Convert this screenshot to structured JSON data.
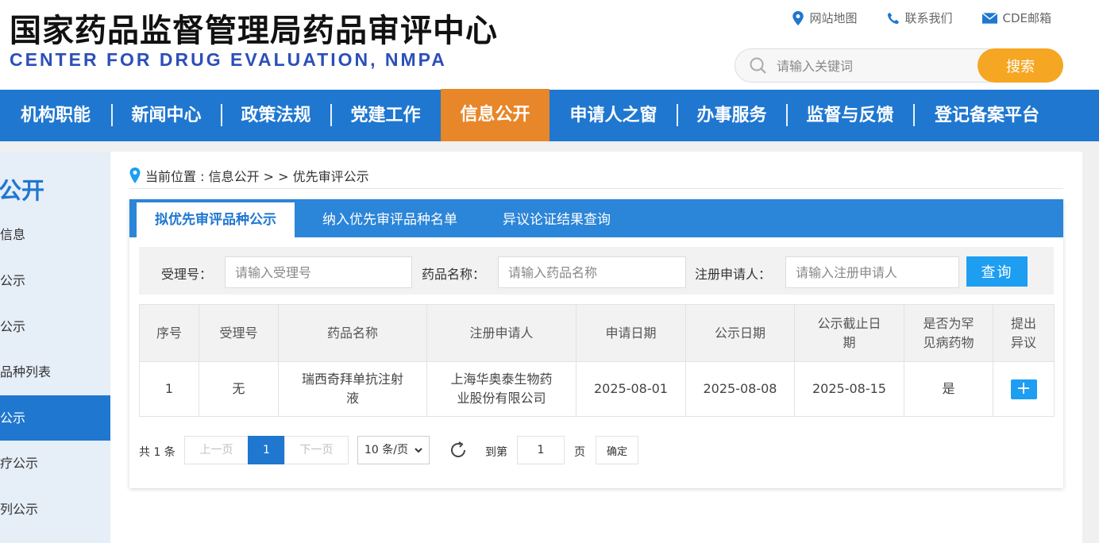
{
  "header": {
    "title": "国家药品监督管理局药品审评中心",
    "subtitle": "CENTER FOR DRUG EVALUATION, NMPA",
    "links": [
      {
        "label": "网站地图",
        "icon": "location-pin-icon"
      },
      {
        "label": "联系我们",
        "icon": "phone-icon"
      },
      {
        "label": "CDE邮箱",
        "icon": "mail-icon"
      }
    ],
    "search": {
      "placeholder": "请输入关键词",
      "button_label": "搜索"
    }
  },
  "nav": {
    "items": [
      {
        "label": "机构职能"
      },
      {
        "label": "新闻中心"
      },
      {
        "label": "政策法规"
      },
      {
        "label": "党建工作"
      },
      {
        "label": "信息公开",
        "active": true
      },
      {
        "label": "申请人之窗"
      },
      {
        "label": "办事服务"
      },
      {
        "label": "监督与反馈"
      },
      {
        "label": "登记备案平台"
      }
    ]
  },
  "sidebar": {
    "title": "公开",
    "items": [
      {
        "label": "信息"
      },
      {
        "label": "公示"
      },
      {
        "label": "公示"
      },
      {
        "label": "品种列表"
      },
      {
        "label": "公示",
        "active": true
      },
      {
        "label": "疗公示"
      },
      {
        "label": "列公示"
      }
    ]
  },
  "breadcrumb": {
    "text": "当前位置 : 信息公开 > > 优先审评公示"
  },
  "tabs": [
    {
      "label": "拟优先审评品种公示",
      "active": true
    },
    {
      "label": "纳入优先审评品种名单"
    },
    {
      "label": "异议论证结果查询"
    }
  ],
  "filter": {
    "accept_no_label": "受理号：",
    "accept_no_placeholder": "请输入受理号",
    "drug_name_label": "药品名称：",
    "drug_name_placeholder": "请输入药品名称",
    "applicant_label": "注册申请人：",
    "applicant_placeholder": "请输入注册申请人",
    "query_label": "查询"
  },
  "table": {
    "headers": [
      "序号",
      "受理号",
      "药品名称",
      "注册申请人",
      "申请日期",
      "公示日期",
      "公示截止日期",
      "是否为罕见病药物",
      "提出异议"
    ],
    "rows": [
      {
        "index": "1",
        "accept_no": "无",
        "drug_name": "瑞西奇拜单抗注射液",
        "applicant": "上海华奥泰生物药业股份有限公司",
        "apply_date": "2025-08-01",
        "publish_date": "2025-08-08",
        "deadline": "2025-08-15",
        "rare_disease": "是",
        "objection_label": "+"
      }
    ]
  },
  "pager": {
    "total": "共 1 条",
    "prev": "上一页",
    "current": "1",
    "next": "下一页",
    "page_size": "10 条/页",
    "goto_label": "到第",
    "goto_value": "1",
    "page_suffix": "页",
    "confirm": "确定"
  }
}
